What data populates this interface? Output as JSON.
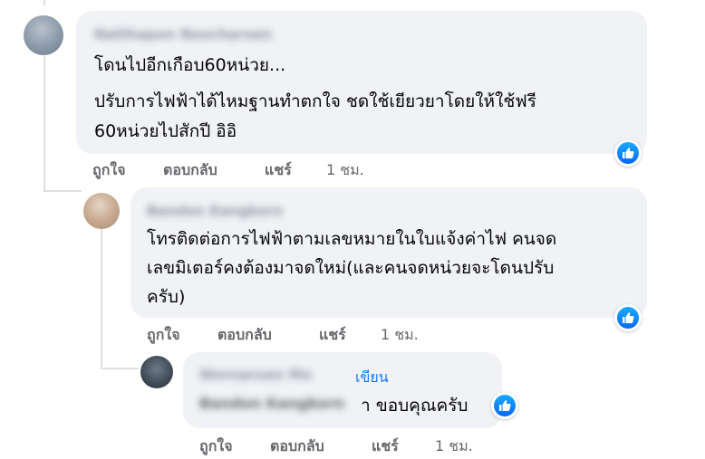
{
  "comments": [
    {
      "author": "Natthapon Noocharoen",
      "lines": [
        "โดนไปอีกเกือบ60หน่วย...",
        "ปรับการไฟฟ้าได้ไหมฐานทำตกใจ ชดใช้เยียวยาโดยให้ใช้ฟรี",
        "60หน่วยไปสักปี อิอิ"
      ],
      "actions": {
        "like": "ถูกใจ",
        "reply": "ตอบกลับ",
        "share": "แชร์",
        "time": "1 ชม."
      }
    },
    {
      "author": "Bandon Kangkorn",
      "lines": [
        "โทรติดต่อการไฟฟ้าตามเลขหมายในใบแจ้งค่าไฟ คนจด",
        "เลขมิเตอร์คงต้องมาจดใหม่(และคนจดหน่วยจะโดนปรับ",
        "ครับ)"
      ],
      "actions": {
        "like": "ถูกใจ",
        "reply": "ตอบกลับ",
        "share": "แชร์",
        "time": "1 ชม."
      }
    },
    {
      "author": "Wornaruen Mo",
      "author_suffix": "เขียน",
      "mention": "Bandon Kangkorn",
      "reply_text": "า ขอบคุณครับ",
      "actions": {
        "like": "ถูกใจ",
        "reply": "ตอบกลับ",
        "share": "แชร์",
        "time": "1 ชม."
      }
    }
  ],
  "icons": {
    "reaction": "like-icon",
    "accent": "#1876f2"
  }
}
